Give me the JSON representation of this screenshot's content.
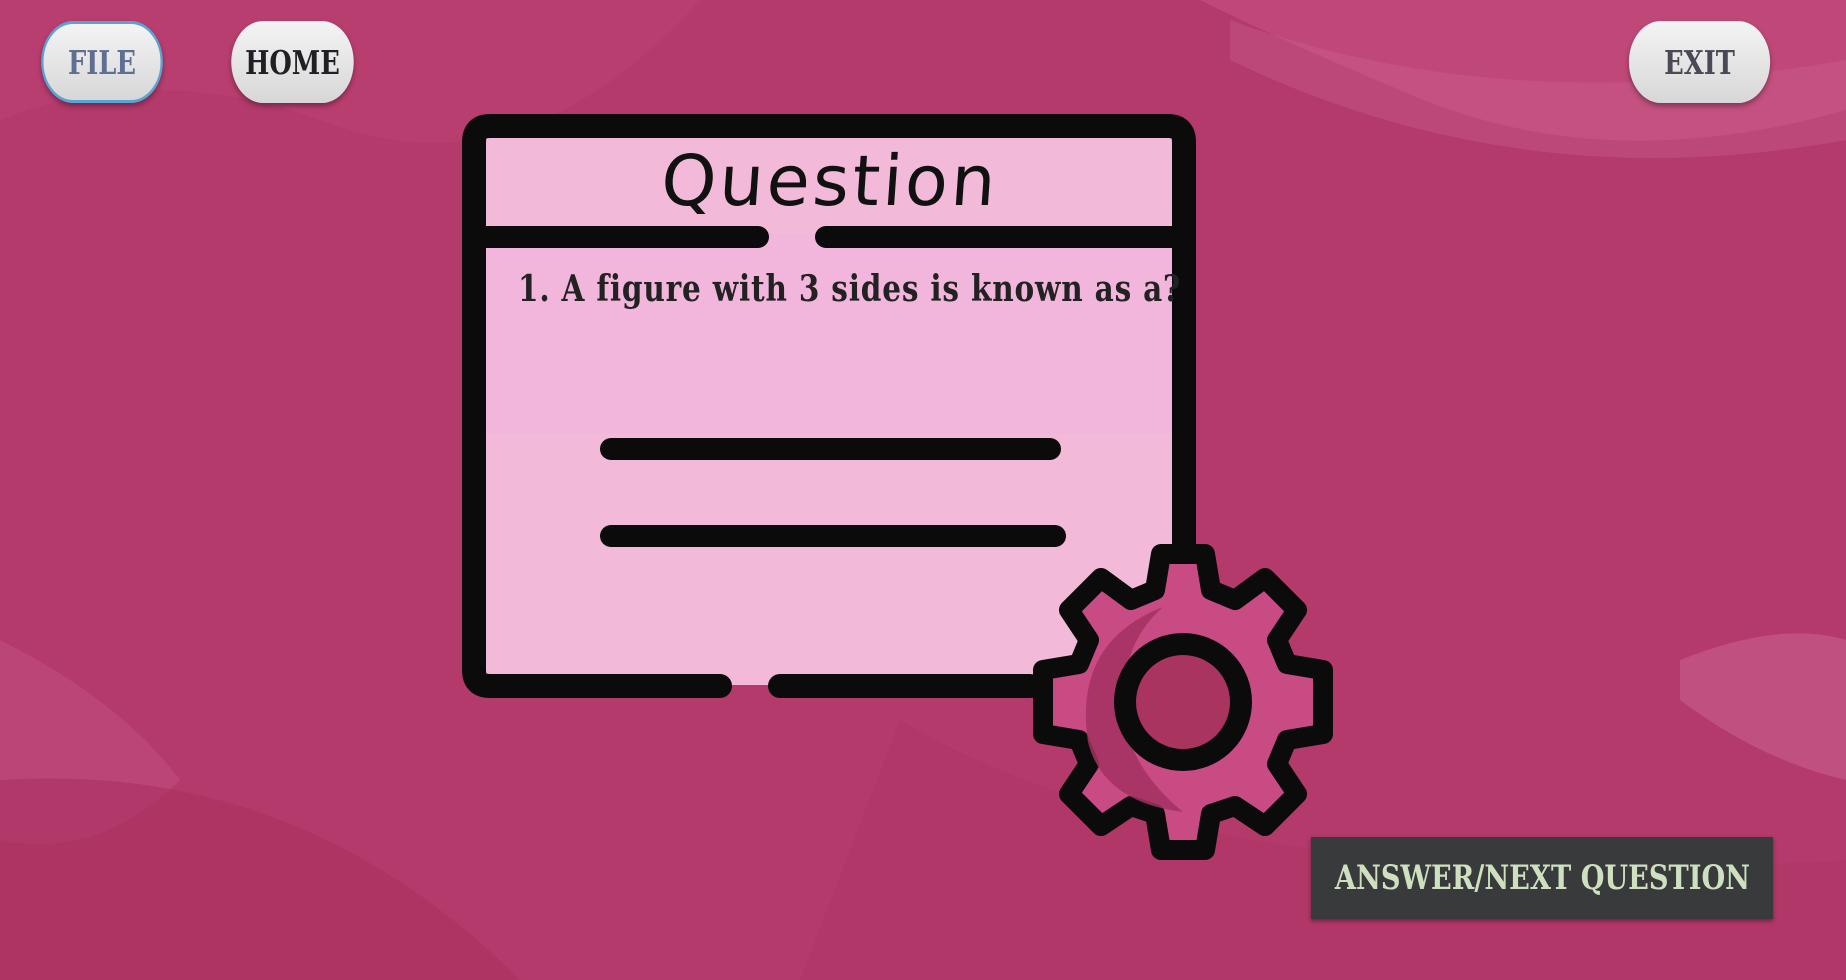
{
  "toolbar": {
    "file_label": "FILE",
    "home_label": "HOME",
    "exit_label": "EXIT"
  },
  "question_card": {
    "title": "Question",
    "text": "1. A figure with 3 sides is known as a?"
  },
  "actions": {
    "answer_next_label": "ANSWER/NEXT QUESTION"
  },
  "colors": {
    "background": "#b43a6c",
    "card_fill": "#f2b9d8",
    "gear": "#c94b83",
    "answer_button": "#383a3c"
  }
}
